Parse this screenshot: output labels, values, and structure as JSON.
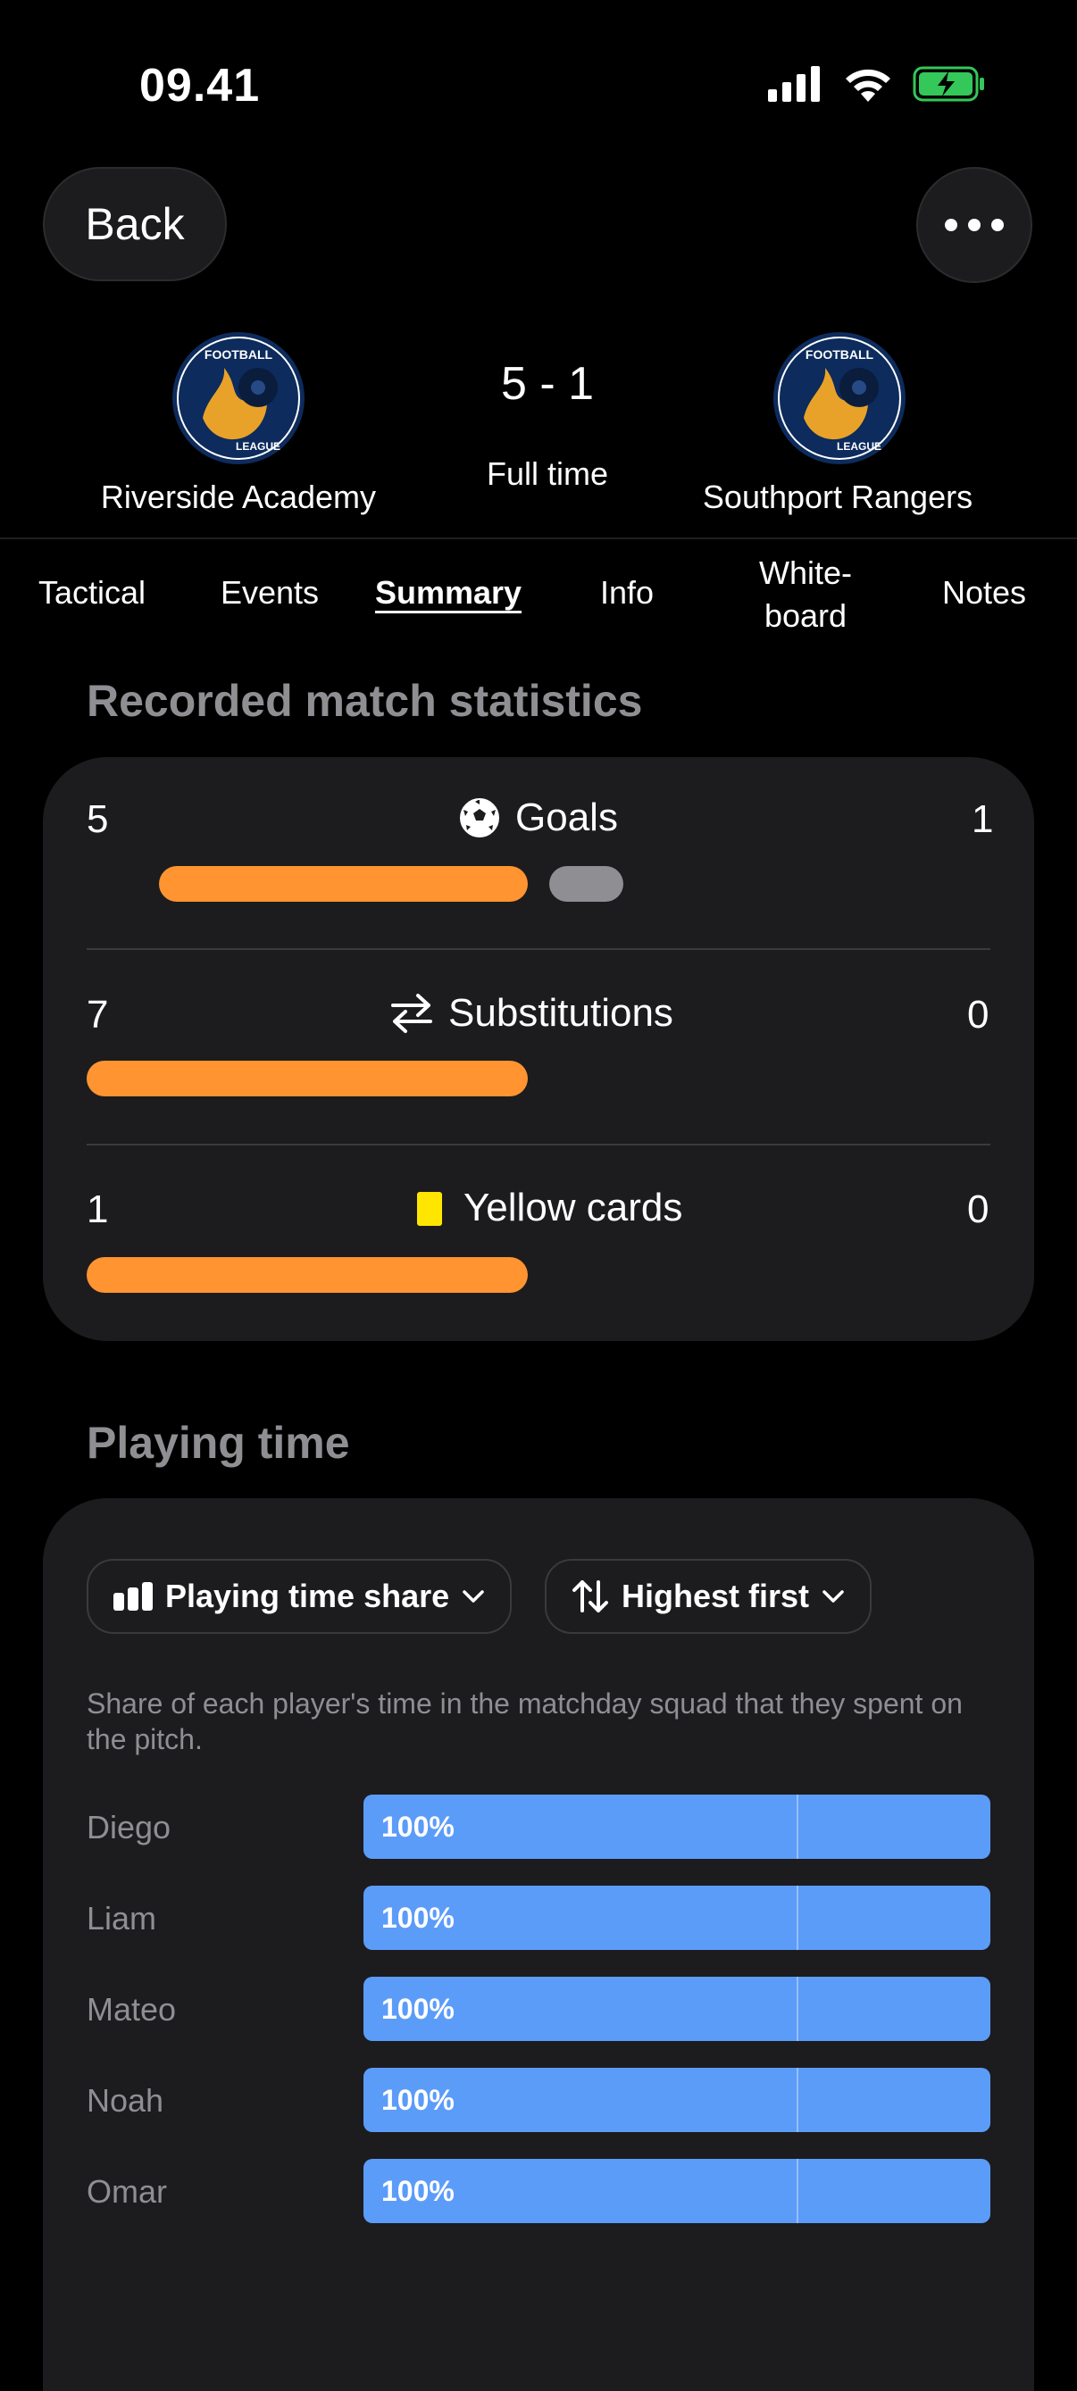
{
  "status_bar": {
    "time": "09.41"
  },
  "header": {
    "back_label": "Back"
  },
  "match": {
    "home_team": "Riverside Academy",
    "away_team": "Southport Rangers",
    "score": "5 - 1",
    "status": "Full time",
    "logo_text_top": "FOOTBALL",
    "logo_text_bottom": "LEAGUE"
  },
  "tabs": [
    {
      "label": "Tactical"
    },
    {
      "label": "Events"
    },
    {
      "label": "Summary",
      "active": true
    },
    {
      "label": "Info"
    },
    {
      "label": "White-",
      "label2": "board"
    },
    {
      "label": "Notes"
    }
  ],
  "stats": {
    "title": "Recorded match statistics",
    "rows": [
      {
        "label": "Goals",
        "icon": "soccer-ball-icon",
        "home": "5",
        "away": "1"
      },
      {
        "label": "Substitutions",
        "icon": "swap-arrows-icon",
        "home": "7",
        "away": "0"
      },
      {
        "label": "Yellow cards",
        "icon": "yellow-card-icon",
        "home": "1",
        "away": "0"
      }
    ]
  },
  "playing_time": {
    "title": "Playing time",
    "filter_label": "Playing time share",
    "sort_label": "Highest first",
    "description": "Share of each player's time in the matchday squad that they spent on the pitch.",
    "players": [
      {
        "name": "Diego",
        "value": "100%"
      },
      {
        "name": "Liam",
        "value": "100%"
      },
      {
        "name": "Mateo",
        "value": "100%"
      },
      {
        "name": "Noah",
        "value": "100%"
      },
      {
        "name": "Omar",
        "value": "100%"
      }
    ]
  },
  "colors": {
    "accent_orange": "#ff9430",
    "bar_blue": "#5c9cf9",
    "card_bg": "#1c1c1e"
  }
}
